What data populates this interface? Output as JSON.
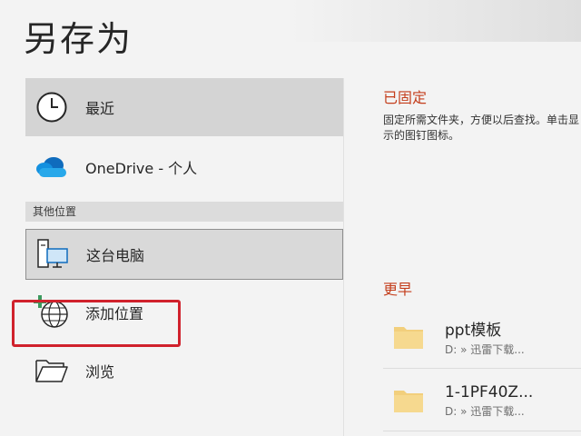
{
  "page": {
    "title": "另存为"
  },
  "nav": {
    "recent": {
      "label": "最近",
      "icon": "clock-icon"
    },
    "onedrive": {
      "label": "OneDrive - 个人",
      "icon": "cloud-icon"
    },
    "other_locations_header": "其他位置",
    "this_pc": {
      "label": "这台电脑",
      "icon": "computer-icon"
    },
    "add_location": {
      "label": "添加位置",
      "icon": "globe-add-icon"
    },
    "browse": {
      "label": "浏览",
      "icon": "folder-open-icon"
    }
  },
  "pinned": {
    "title": "已固定",
    "description": "固定所需文件夹，方便以后查找。单击显示的图钉图标。"
  },
  "earlier": {
    "title": "更早",
    "items": [
      {
        "name": "ppt模板",
        "path": "D: » 迅雷下载..."
      },
      {
        "name": "1-1PF40Z...",
        "path": "D: » 迅雷下载..."
      }
    ]
  },
  "colors": {
    "accent": "#c43e1c",
    "highlight_border": "#d0212c",
    "folder": "#f2cf7c",
    "onedrive_blue": "#0f6cbd"
  }
}
